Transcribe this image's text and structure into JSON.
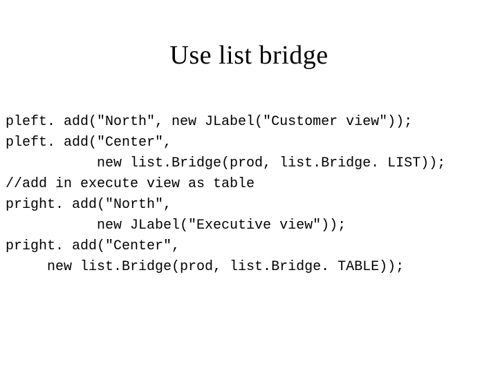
{
  "title": "Use list bridge",
  "code": {
    "l1": "pleft. add(\"North\", new JLabel(\"Customer view\"));",
    "l2": "pleft. add(\"Center\",",
    "l3": "           new list.Bridge(prod, list.Bridge. LIST));",
    "l4": "//add in execute view as table",
    "l5": "pright. add(\"North\",",
    "l6": "           new JLabel(\"Executive view\"));",
    "l7": "pright. add(\"Center\",",
    "l8": "     new list.Bridge(prod, list.Bridge. TABLE));"
  }
}
